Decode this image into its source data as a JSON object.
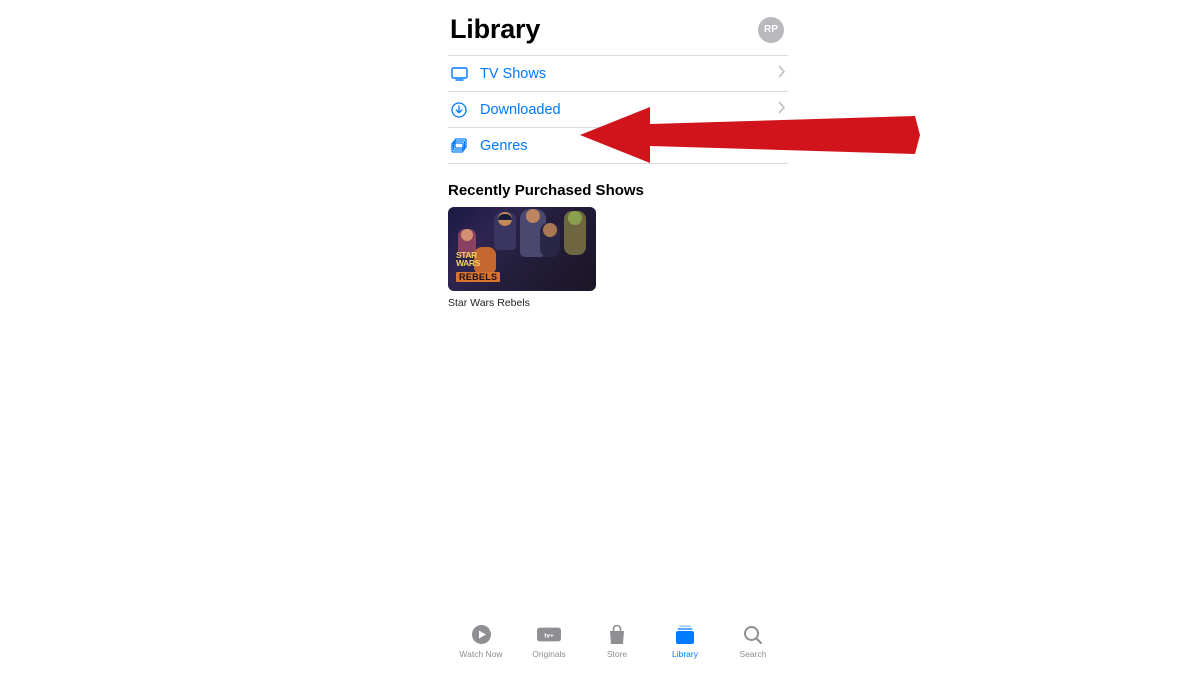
{
  "header": {
    "title": "Library",
    "avatar_initials": "RP"
  },
  "list": {
    "items": [
      {
        "label": "TV Shows",
        "icon": "tv-icon"
      },
      {
        "label": "Downloaded",
        "icon": "download-icon"
      },
      {
        "label": "Genres",
        "icon": "genres-icon"
      }
    ]
  },
  "section": {
    "title": "Recently Purchased Shows",
    "items": [
      {
        "title": "Star Wars Rebels",
        "logo_top": "STAR",
        "logo_mid": "WARS",
        "logo_sub": "REBELS"
      }
    ]
  },
  "tabs": {
    "items": [
      {
        "label": "Watch Now",
        "icon": "play-circle-icon",
        "active": false
      },
      {
        "label": "Originals",
        "icon": "apple-tv-icon",
        "active": false
      },
      {
        "label": "Store",
        "icon": "bag-icon",
        "active": false
      },
      {
        "label": "Library",
        "icon": "library-icon",
        "active": true
      },
      {
        "label": "Search",
        "icon": "search-icon",
        "active": false
      }
    ]
  },
  "colors": {
    "accent": "#007aff",
    "red": "#d1141b"
  }
}
